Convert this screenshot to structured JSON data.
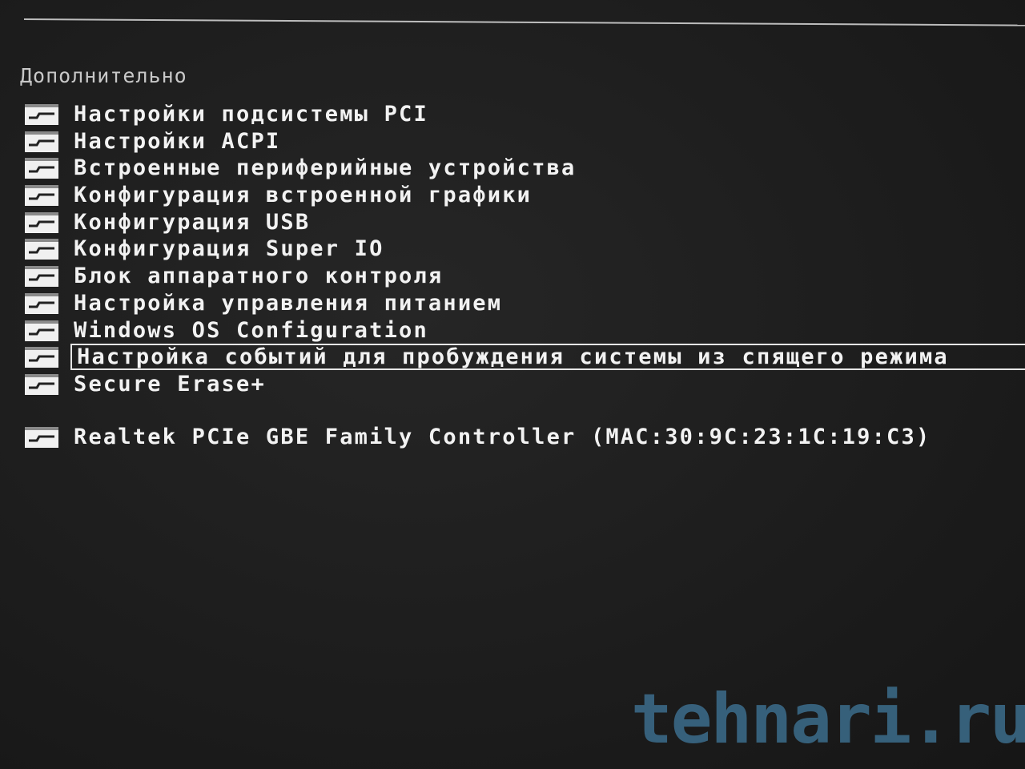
{
  "section": {
    "title": "Дополнительно"
  },
  "menu": {
    "items": [
      {
        "label": "Настройки подсистемы  PCI"
      },
      {
        "label": "Настройки ACPI"
      },
      {
        "label": "Встроенные периферийные устройства"
      },
      {
        "label": "Конфигурация встроенной графики"
      },
      {
        "label": "Конфигурация USB"
      },
      {
        "label": "Конфигурация Super IO"
      },
      {
        "label": "Блок аппаратного контроля"
      },
      {
        "label": "Настройка управления питанием"
      },
      {
        "label": "Windows OS Configuration"
      },
      {
        "label": "Настройка событий для пробуждения системы из спящего режима",
        "selected": true
      },
      {
        "label": "Secure Erase+"
      }
    ],
    "network_item": {
      "label": "Realtek PCIe GBE Family Controller (MAC:30:9C:23:1C:19:C3)"
    }
  },
  "icons": {
    "submenu": "folder-icon"
  },
  "colors": {
    "background": "#1c1c1c",
    "text": "#f2f2f2",
    "watermark": "#3c6d8c"
  },
  "watermark": {
    "text": "tehnari.ru"
  }
}
